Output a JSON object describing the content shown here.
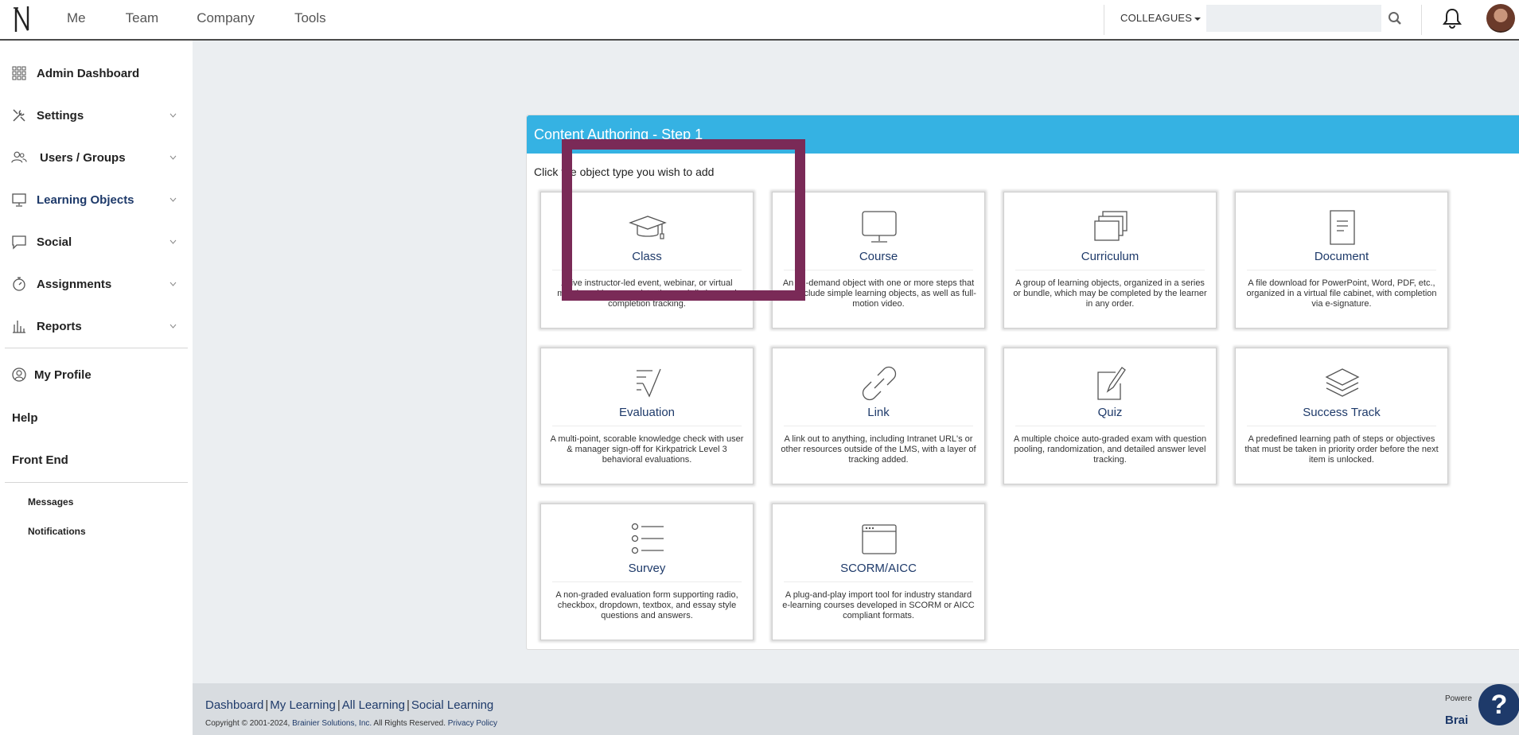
{
  "topbar": {
    "nav": [
      "Me",
      "Team",
      "Company",
      "Tools"
    ],
    "colleagues_label": "COLLEAGUES",
    "search_placeholder": "",
    "icons": {
      "search": "search-icon",
      "bell": "bell-icon",
      "avatar": "user-avatar"
    }
  },
  "sidebar": {
    "items": [
      {
        "label": "Admin Dashboard",
        "icon": "grid-icon",
        "has_chevron": false
      },
      {
        "label": "Settings",
        "icon": "tools-icon",
        "has_chevron": true
      },
      {
        "label": "Users / Groups",
        "icon": "users-icon",
        "has_chevron": true
      },
      {
        "label": "Learning Objects",
        "icon": "monitor-icon",
        "has_chevron": true,
        "active": true
      },
      {
        "label": "Social",
        "icon": "chat-icon",
        "has_chevron": true
      },
      {
        "label": "Assignments",
        "icon": "stopwatch-icon",
        "has_chevron": true
      },
      {
        "label": "Reports",
        "icon": "bar-chart-icon",
        "has_chevron": true
      }
    ],
    "my_profile": "My Profile",
    "help": "Help",
    "front_end": "Front End",
    "messages": "Messages",
    "notifications": "Notifications"
  },
  "panel": {
    "title": "Content Authoring - Step 1",
    "instruction": "Click the object type you wish to add",
    "cards": [
      {
        "title": "Class",
        "desc": "A live instructor-led event, webinar, or virtual meeting with user registration, wait-listing, and completion tracking.",
        "icon": "graduation-cap-icon"
      },
      {
        "title": "Course",
        "desc": "An on-demand object with one or more steps that can include simple learning objects, as well as full-motion video.",
        "icon": "monitor-icon",
        "highlighted": true
      },
      {
        "title": "Curriculum",
        "desc": "A group of learning objects, organized in a series or bundle, which may be completed by the learner in any order.",
        "icon": "stacked-windows-icon"
      },
      {
        "title": "Document",
        "desc": "A file download for PowerPoint, Word, PDF, etc., organized in a virtual file cabinet, with completion via e-signature.",
        "icon": "document-icon"
      },
      {
        "title": "Evaluation",
        "desc": "A multi-point, scorable knowledge check with user & manager sign-off for Kirkpatrick Level 3 behavioral evaluations.",
        "icon": "checklist-icon"
      },
      {
        "title": "Link",
        "desc": "A link out to anything, including Intranet URL's or other resources outside of the LMS, with a layer of tracking added.",
        "icon": "link-icon"
      },
      {
        "title": "Quiz",
        "desc": "A multiple choice auto-graded exam with question pooling, randomization, and detailed answer level tracking.",
        "icon": "quiz-pencil-icon"
      },
      {
        "title": "Success Track",
        "desc": "A predefined learning path of steps or objectives that must be taken in priority order before the next item is unlocked.",
        "icon": "layers-icon"
      },
      {
        "title": "Survey",
        "desc": "A non-graded evaluation form supporting radio, checkbox, dropdown, textbox, and essay style questions and answers.",
        "icon": "list-icon"
      },
      {
        "title": "SCORM/AICC",
        "desc": "A plug-and-play import tool for industry standard e-learning courses developed in SCORM or AICC compliant formats.",
        "icon": "browser-window-icon"
      }
    ]
  },
  "footer": {
    "links": [
      "Dashboard",
      "My Learning",
      "All Learning",
      "Social Learning"
    ],
    "copyright_prefix": "Copyright © 2001-2024, ",
    "company": "Brainier Solutions, Inc.",
    "rights": " All Rights Reserved. ",
    "privacy": "Privacy Policy",
    "powered": "Powere",
    "brand": "Brai",
    "help_label": "?"
  }
}
